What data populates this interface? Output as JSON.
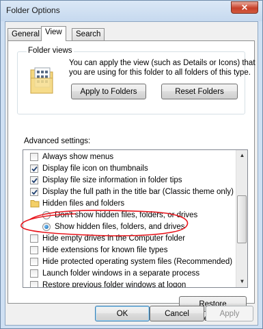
{
  "window": {
    "title": "Folder Options",
    "close_glyph": "✕"
  },
  "tabs": [
    {
      "label": "General",
      "active": false
    },
    {
      "label": "View",
      "active": true
    },
    {
      "label": "Search",
      "active": false
    }
  ],
  "folder_views": {
    "legend": "Folder views",
    "description_line1": "You can apply the view (such as Details or Icons) that",
    "description_line2": "you are using for this folder to all folders of this type.",
    "apply_label": "Apply to Folders",
    "reset_label": "Reset Folders",
    "icon": "folder-grid-icon"
  },
  "advanced": {
    "legend": "Advanced settings:",
    "items": [
      {
        "kind": "checkbox",
        "label": "Always show menus",
        "checked": false,
        "indent": 0
      },
      {
        "kind": "checkbox",
        "label": "Display file icon on thumbnails",
        "checked": true,
        "indent": 0
      },
      {
        "kind": "checkbox",
        "label": "Display file size information in folder tips",
        "checked": true,
        "indent": 0
      },
      {
        "kind": "checkbox",
        "label": "Display the full path in the title bar (Classic theme only)",
        "checked": true,
        "indent": 0
      },
      {
        "kind": "folder",
        "label": "Hidden files and folders",
        "indent": 0
      },
      {
        "kind": "radio",
        "label": "Don't show hidden files, folders, or drives",
        "checked": false,
        "indent": 1
      },
      {
        "kind": "radio",
        "label": "Show hidden files, folders, and drives",
        "checked": true,
        "indent": 1
      },
      {
        "kind": "checkbox",
        "label": "Hide empty drives in the Computer folder",
        "checked": false,
        "indent": 0
      },
      {
        "kind": "checkbox",
        "label": "Hide extensions for known file types",
        "checked": false,
        "indent": 0
      },
      {
        "kind": "checkbox",
        "label": "Hide protected operating system files (Recommended)",
        "checked": false,
        "indent": 0
      },
      {
        "kind": "checkbox",
        "label": "Launch folder windows in a separate process",
        "checked": false,
        "indent": 0
      },
      {
        "kind": "checkbox",
        "label": "Restore previous folder windows at logon",
        "checked": false,
        "indent": 0
      }
    ]
  },
  "scrollbar": {
    "up": "▲",
    "down": "▼"
  },
  "restore_defaults_label": "Restore Defaults",
  "footer": {
    "ok_label": "OK",
    "cancel_label": "Cancel",
    "apply_label": "Apply"
  },
  "colors": {
    "annotation": "#e8141b",
    "checkmark": "#1e3f70"
  }
}
